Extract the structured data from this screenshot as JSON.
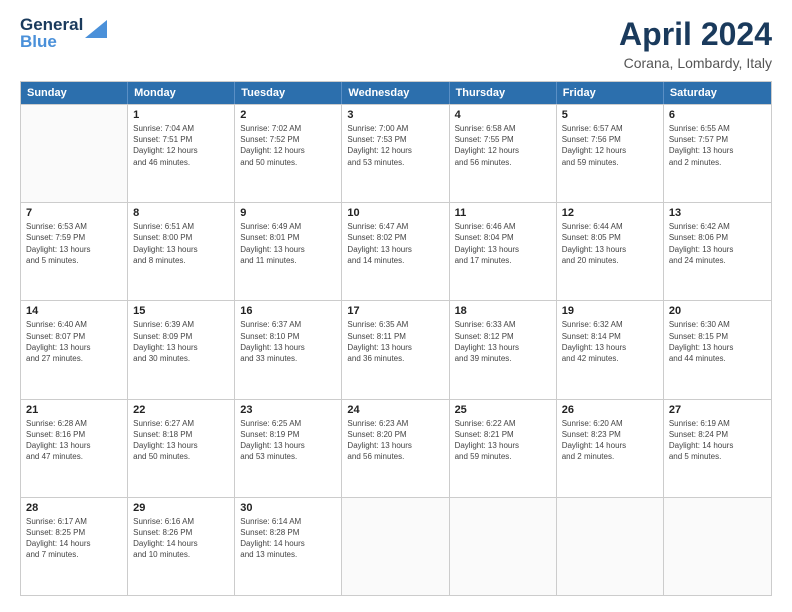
{
  "header": {
    "logo_line1": "General",
    "logo_line2": "Blue",
    "month": "April 2024",
    "location": "Corana, Lombardy, Italy"
  },
  "days_of_week": [
    "Sunday",
    "Monday",
    "Tuesday",
    "Wednesday",
    "Thursday",
    "Friday",
    "Saturday"
  ],
  "weeks": [
    [
      {
        "day": "",
        "detail": ""
      },
      {
        "day": "1",
        "detail": "Sunrise: 7:04 AM\nSunset: 7:51 PM\nDaylight: 12 hours\nand 46 minutes."
      },
      {
        "day": "2",
        "detail": "Sunrise: 7:02 AM\nSunset: 7:52 PM\nDaylight: 12 hours\nand 50 minutes."
      },
      {
        "day": "3",
        "detail": "Sunrise: 7:00 AM\nSunset: 7:53 PM\nDaylight: 12 hours\nand 53 minutes."
      },
      {
        "day": "4",
        "detail": "Sunrise: 6:58 AM\nSunset: 7:55 PM\nDaylight: 12 hours\nand 56 minutes."
      },
      {
        "day": "5",
        "detail": "Sunrise: 6:57 AM\nSunset: 7:56 PM\nDaylight: 12 hours\nand 59 minutes."
      },
      {
        "day": "6",
        "detail": "Sunrise: 6:55 AM\nSunset: 7:57 PM\nDaylight: 13 hours\nand 2 minutes."
      }
    ],
    [
      {
        "day": "7",
        "detail": "Sunrise: 6:53 AM\nSunset: 7:59 PM\nDaylight: 13 hours\nand 5 minutes."
      },
      {
        "day": "8",
        "detail": "Sunrise: 6:51 AM\nSunset: 8:00 PM\nDaylight: 13 hours\nand 8 minutes."
      },
      {
        "day": "9",
        "detail": "Sunrise: 6:49 AM\nSunset: 8:01 PM\nDaylight: 13 hours\nand 11 minutes."
      },
      {
        "day": "10",
        "detail": "Sunrise: 6:47 AM\nSunset: 8:02 PM\nDaylight: 13 hours\nand 14 minutes."
      },
      {
        "day": "11",
        "detail": "Sunrise: 6:46 AM\nSunset: 8:04 PM\nDaylight: 13 hours\nand 17 minutes."
      },
      {
        "day": "12",
        "detail": "Sunrise: 6:44 AM\nSunset: 8:05 PM\nDaylight: 13 hours\nand 20 minutes."
      },
      {
        "day": "13",
        "detail": "Sunrise: 6:42 AM\nSunset: 8:06 PM\nDaylight: 13 hours\nand 24 minutes."
      }
    ],
    [
      {
        "day": "14",
        "detail": "Sunrise: 6:40 AM\nSunset: 8:07 PM\nDaylight: 13 hours\nand 27 minutes."
      },
      {
        "day": "15",
        "detail": "Sunrise: 6:39 AM\nSunset: 8:09 PM\nDaylight: 13 hours\nand 30 minutes."
      },
      {
        "day": "16",
        "detail": "Sunrise: 6:37 AM\nSunset: 8:10 PM\nDaylight: 13 hours\nand 33 minutes."
      },
      {
        "day": "17",
        "detail": "Sunrise: 6:35 AM\nSunset: 8:11 PM\nDaylight: 13 hours\nand 36 minutes."
      },
      {
        "day": "18",
        "detail": "Sunrise: 6:33 AM\nSunset: 8:12 PM\nDaylight: 13 hours\nand 39 minutes."
      },
      {
        "day": "19",
        "detail": "Sunrise: 6:32 AM\nSunset: 8:14 PM\nDaylight: 13 hours\nand 42 minutes."
      },
      {
        "day": "20",
        "detail": "Sunrise: 6:30 AM\nSunset: 8:15 PM\nDaylight: 13 hours\nand 44 minutes."
      }
    ],
    [
      {
        "day": "21",
        "detail": "Sunrise: 6:28 AM\nSunset: 8:16 PM\nDaylight: 13 hours\nand 47 minutes."
      },
      {
        "day": "22",
        "detail": "Sunrise: 6:27 AM\nSunset: 8:18 PM\nDaylight: 13 hours\nand 50 minutes."
      },
      {
        "day": "23",
        "detail": "Sunrise: 6:25 AM\nSunset: 8:19 PM\nDaylight: 13 hours\nand 53 minutes."
      },
      {
        "day": "24",
        "detail": "Sunrise: 6:23 AM\nSunset: 8:20 PM\nDaylight: 13 hours\nand 56 minutes."
      },
      {
        "day": "25",
        "detail": "Sunrise: 6:22 AM\nSunset: 8:21 PM\nDaylight: 13 hours\nand 59 minutes."
      },
      {
        "day": "26",
        "detail": "Sunrise: 6:20 AM\nSunset: 8:23 PM\nDaylight: 14 hours\nand 2 minutes."
      },
      {
        "day": "27",
        "detail": "Sunrise: 6:19 AM\nSunset: 8:24 PM\nDaylight: 14 hours\nand 5 minutes."
      }
    ],
    [
      {
        "day": "28",
        "detail": "Sunrise: 6:17 AM\nSunset: 8:25 PM\nDaylight: 14 hours\nand 7 minutes."
      },
      {
        "day": "29",
        "detail": "Sunrise: 6:16 AM\nSunset: 8:26 PM\nDaylight: 14 hours\nand 10 minutes."
      },
      {
        "day": "30",
        "detail": "Sunrise: 6:14 AM\nSunset: 8:28 PM\nDaylight: 14 hours\nand 13 minutes."
      },
      {
        "day": "",
        "detail": ""
      },
      {
        "day": "",
        "detail": ""
      },
      {
        "day": "",
        "detail": ""
      },
      {
        "day": "",
        "detail": ""
      }
    ]
  ]
}
